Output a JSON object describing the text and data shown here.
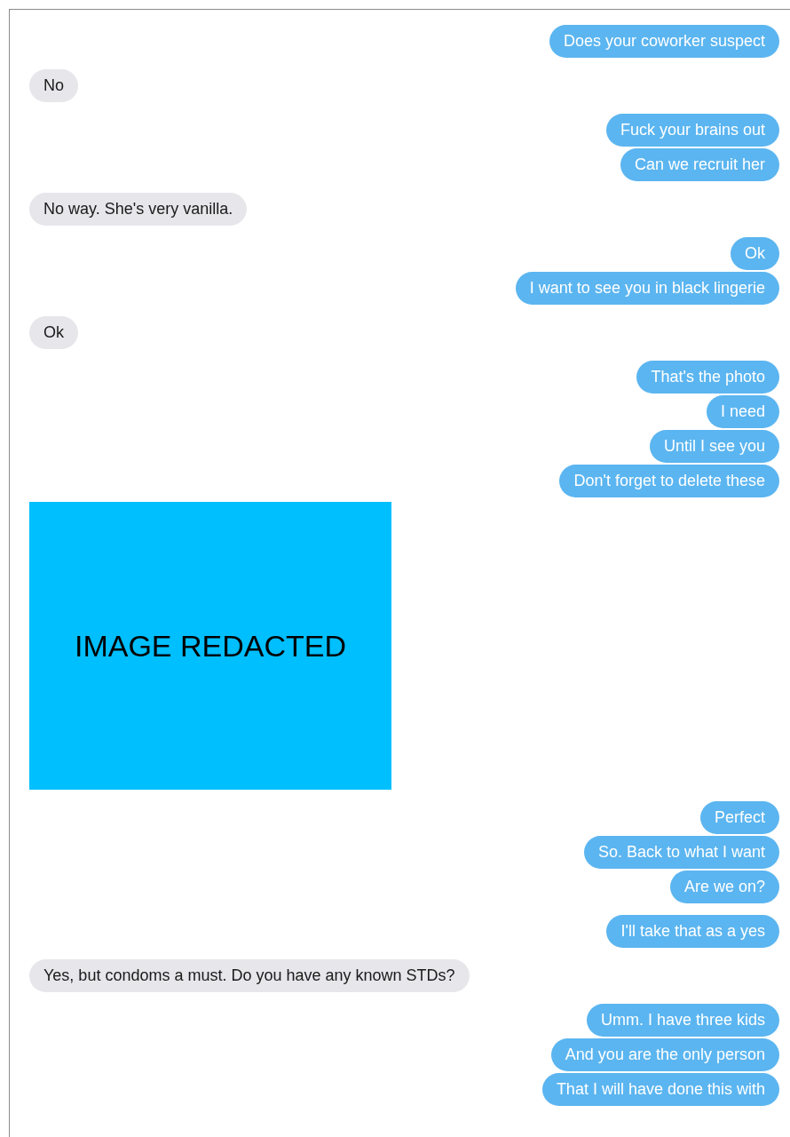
{
  "conversation": [
    {
      "kind": "sent",
      "messages": [
        "Does your coworker suspect"
      ]
    },
    {
      "kind": "received",
      "messages": [
        "No"
      ]
    },
    {
      "kind": "sent",
      "messages": [
        "Fuck your brains out",
        "Can we recruit her"
      ]
    },
    {
      "kind": "received",
      "messages": [
        "No way. She's very vanilla."
      ]
    },
    {
      "kind": "sent",
      "messages": [
        "Ok",
        "I want to see you in black lingerie"
      ]
    },
    {
      "kind": "received",
      "messages": [
        "Ok"
      ]
    },
    {
      "kind": "sent",
      "messages": [
        "That's the photo",
        "I need",
        "Until I see you",
        "Don't forget to delete these"
      ]
    },
    {
      "kind": "image",
      "messages": [
        "IMAGE REDACTED"
      ]
    },
    {
      "kind": "sent",
      "messages": [
        "Perfect",
        "So. Back to what I want",
        "Are we on?"
      ]
    },
    {
      "kind": "sent",
      "messages": [
        "I'll take that as a yes"
      ]
    },
    {
      "kind": "received",
      "messages": [
        "Yes, but condoms a must. Do you have any known STDs?"
      ]
    },
    {
      "kind": "sent",
      "messages": [
        "Umm. I have three kids",
        "And you are the only person",
        "That I will have done this with"
      ]
    }
  ]
}
